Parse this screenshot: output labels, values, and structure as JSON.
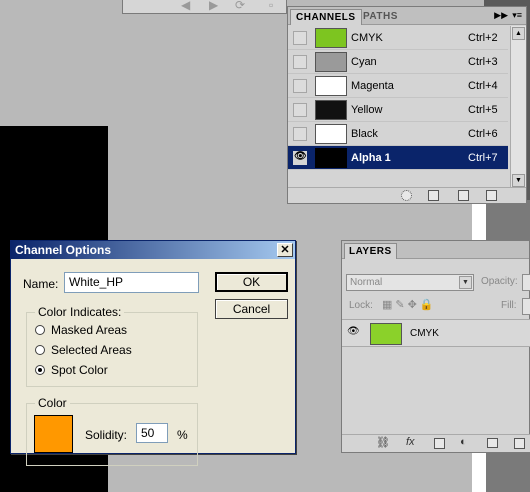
{
  "channels_panel": {
    "tabs": [
      "CHANNELS",
      "PATHS"
    ],
    "menu_icon": "panel-menu-icon",
    "rows": [
      {
        "name": "CMYK",
        "shortcut": "Ctrl+2",
        "thumb": "#7dc520",
        "selected": false,
        "visible": false
      },
      {
        "name": "Cyan",
        "shortcut": "Ctrl+3",
        "thumb": "#9a9a9a",
        "selected": false,
        "visible": false
      },
      {
        "name": "Magenta",
        "shortcut": "Ctrl+4",
        "thumb": "#ffffff",
        "selected": false,
        "visible": false
      },
      {
        "name": "Yellow",
        "shortcut": "Ctrl+5",
        "thumb": "#111111",
        "selected": false,
        "visible": false
      },
      {
        "name": "Black",
        "shortcut": "Ctrl+6",
        "thumb": "#ffffff",
        "selected": false,
        "visible": false
      },
      {
        "name": "Alpha 1",
        "shortcut": "Ctrl+7",
        "thumb": "#000000",
        "selected": true,
        "visible": true
      }
    ]
  },
  "layers_panel": {
    "tab": "LAYERS",
    "blend_mode": "Normal",
    "opacity_label": "Opacity:",
    "lock_label": "Lock:",
    "fill_label": "Fill:",
    "layer": {
      "name": "CMYK"
    },
    "footer_icons": [
      "link-icon",
      "fx-icon",
      "mask-icon",
      "adjustment-icon",
      "group-icon",
      "new-layer-icon"
    ]
  },
  "dialog": {
    "title": "Channel Options",
    "close": "✕",
    "name_label": "Name:",
    "name_value": "White_HP",
    "ok_label": "OK",
    "cancel_label": "Cancel",
    "indicates_legend": "Color Indicates:",
    "options": [
      {
        "label": "Masked Areas",
        "checked": false
      },
      {
        "label": "Selected Areas",
        "checked": false
      },
      {
        "label": "Spot Color",
        "checked": true
      }
    ],
    "color_legend": "Color",
    "swatch_color": "#ff9800",
    "solidity_label": "Solidity:",
    "solidity_value": "50",
    "percent": "%"
  }
}
